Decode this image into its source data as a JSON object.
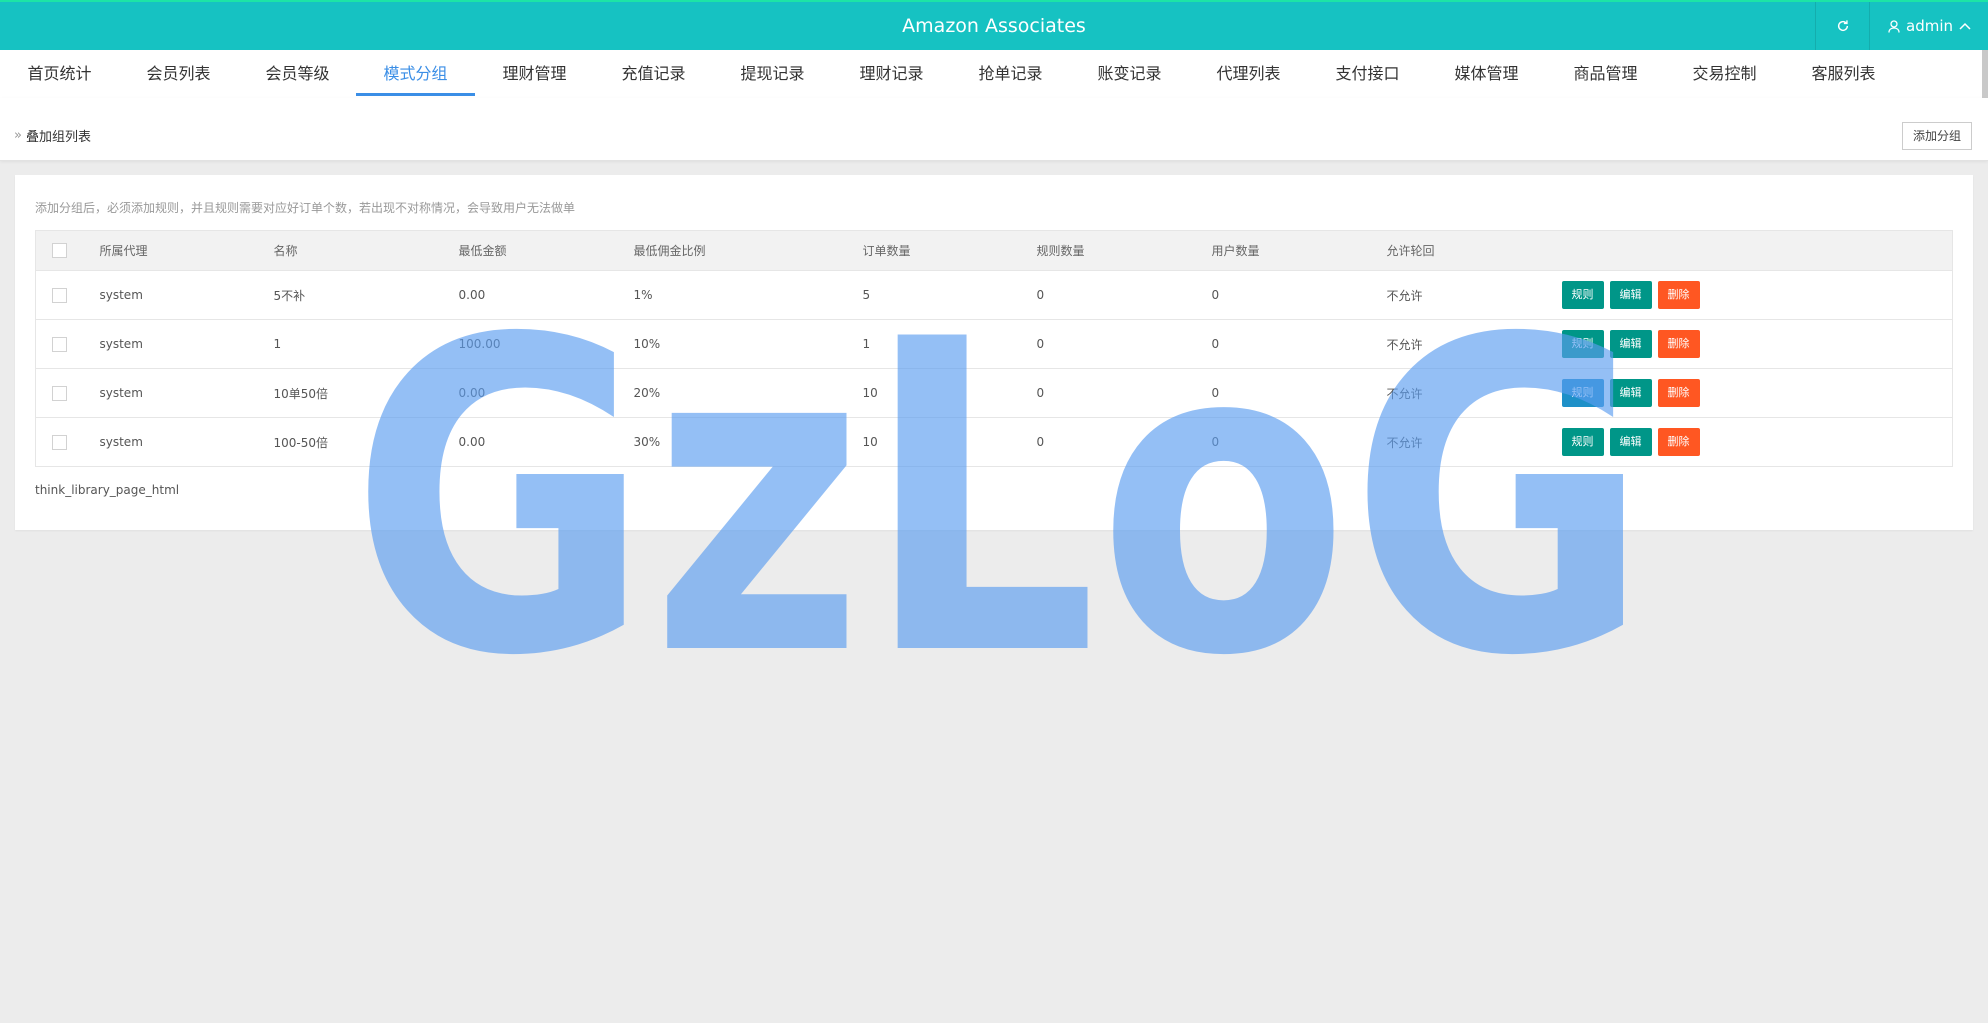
{
  "app": {
    "title": "Amazon Associates",
    "user": "admin"
  },
  "nav": {
    "tabs": [
      "首页统计",
      "会员列表",
      "会员等级",
      "模式分组",
      "理财管理",
      "充值记录",
      "提现记录",
      "理财记录",
      "抢单记录",
      "账变记录",
      "代理列表",
      "支付接口",
      "媒体管理",
      "商品管理",
      "交易控制",
      "客服列表"
    ],
    "active_index": 3
  },
  "breadcrumb": {
    "label": "叠加组列表"
  },
  "toolbar": {
    "add_label": "添加分组"
  },
  "main": {
    "hint": "添加分组后，必须添加规则，并且规则需要对应好订单个数，若出现不对称情况，会导致用户无法做单",
    "columns": [
      "所属代理",
      "名称",
      "最低金额",
      "最低佣金比例",
      "订单数量",
      "规则数量",
      "用户数量",
      "允许轮回"
    ],
    "rows": [
      {
        "agent": "system",
        "name": "5不补",
        "min_amount": "0.00",
        "min_rate": "1%",
        "orders": "5",
        "rules": "0",
        "users": "0",
        "loop": "不允许"
      },
      {
        "agent": "system",
        "name": "1",
        "min_amount": "100.00",
        "min_rate": "10%",
        "orders": "1",
        "rules": "0",
        "users": "0",
        "loop": "不允许"
      },
      {
        "agent": "system",
        "name": "10单50倍",
        "min_amount": "0.00",
        "min_rate": "20%",
        "orders": "10",
        "rules": "0",
        "users": "0",
        "loop": "不允许"
      },
      {
        "agent": "system",
        "name": "100-50倍",
        "min_amount": "0.00",
        "min_rate": "30%",
        "orders": "10",
        "rules": "0",
        "users": "0",
        "loop": "不允许"
      }
    ],
    "actions": {
      "rules": "规则",
      "edit": "编辑",
      "delete": "删除"
    },
    "pager": "think_library_page_html"
  },
  "watermark": {
    "text": "GzLoG",
    "color": "#5b9cf0"
  },
  "colors": {
    "topbar": "#16c2c2",
    "accent": "#3a8ee6",
    "teal": "#009688",
    "orange": "#ff5722"
  }
}
